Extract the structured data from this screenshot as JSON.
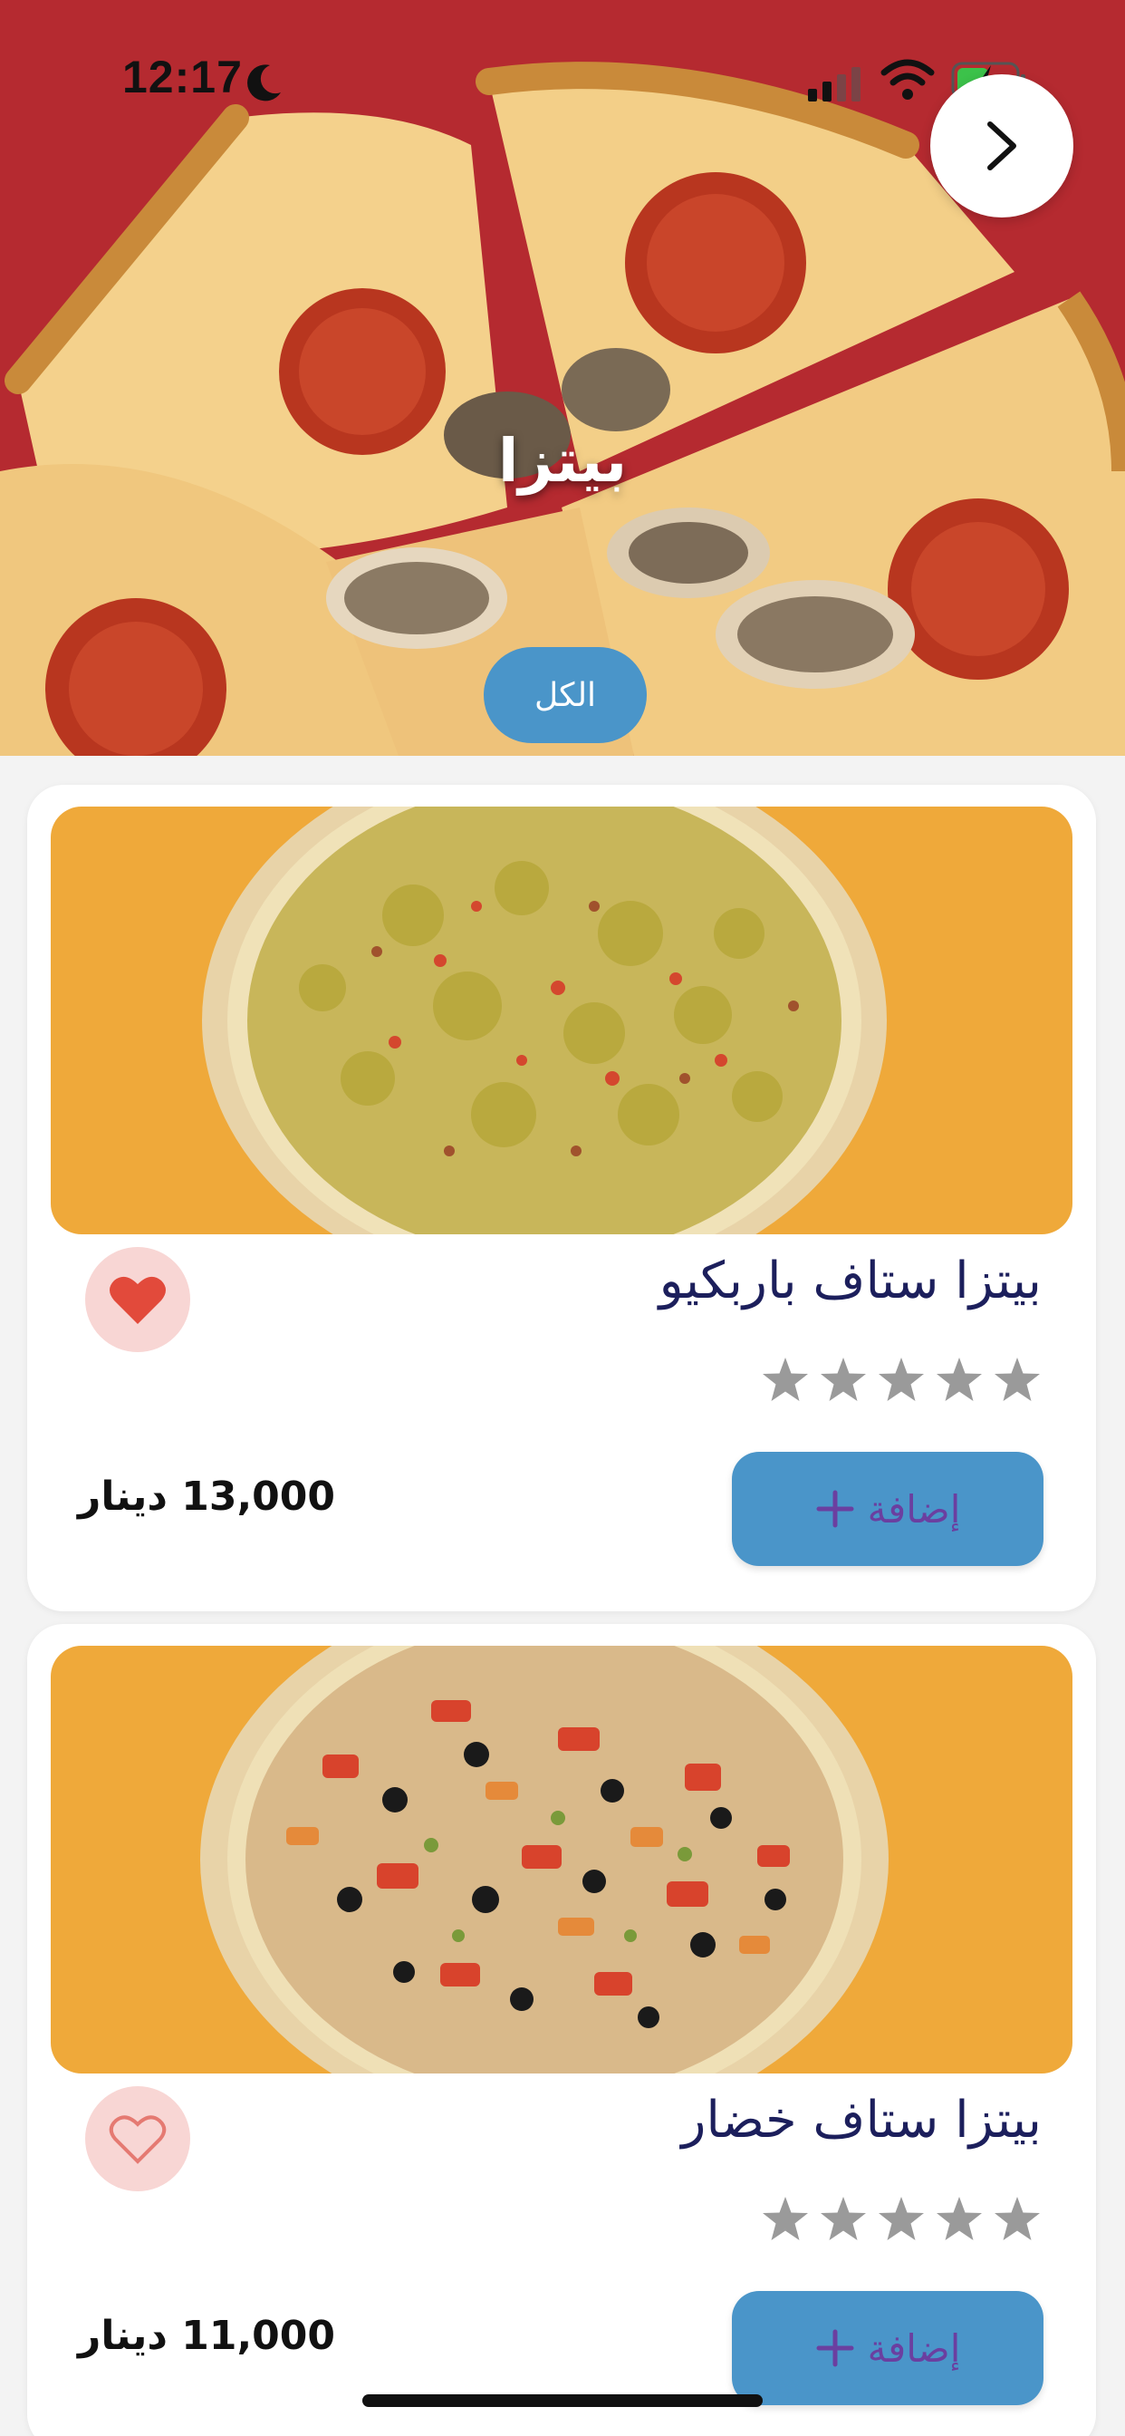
{
  "status_bar": {
    "time": "12:17",
    "icons": [
      "moon-icon",
      "signal-icon",
      "wifi-icon",
      "battery-charging-icon"
    ]
  },
  "header": {
    "back_icon": "chevron-right-icon",
    "title": "بيتزا",
    "filter_chip": "الكل"
  },
  "colors": {
    "accent_blue": "#4a95c9",
    "hero_red": "#b52a30",
    "card_image_bg": "#efa93a",
    "favorite_red": "#e24a3b",
    "favorite_bg": "#f8d6d4",
    "title_navy": "#1c1f5c",
    "add_label_purple": "#6b3fa0",
    "star_gray": "#9a9a9a"
  },
  "products": [
    {
      "name": "بيتزا ستاف باربكيو",
      "rating": 0,
      "rating_max": 5,
      "price": "13,000 دينار",
      "add_label": "إضافة",
      "favorite": true
    },
    {
      "name": "بيتزا ستاف خضار",
      "rating": 0,
      "rating_max": 5,
      "price": "11,000 دينار",
      "add_label": "إضافة",
      "favorite": false
    }
  ]
}
